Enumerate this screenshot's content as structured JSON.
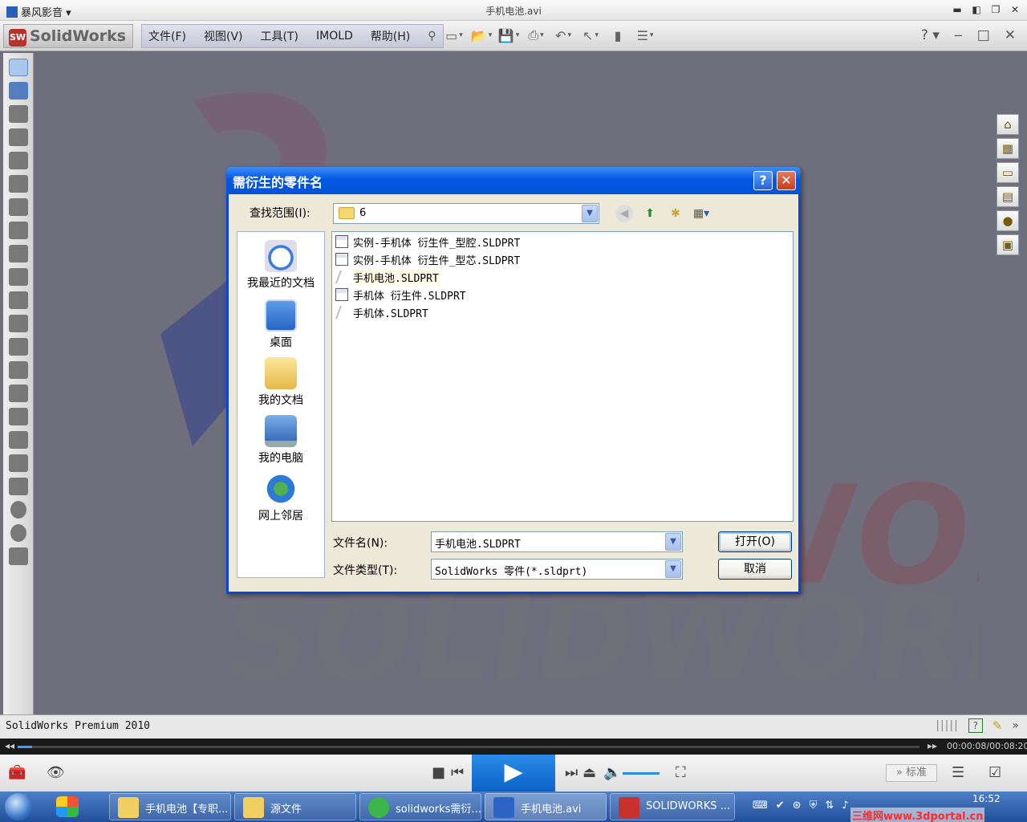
{
  "player": {
    "app_name": "暴风影音",
    "file_title": "手机电池.avi",
    "progress_fraction": 0.016,
    "time_readout": "00:00:08/00:08:20",
    "mode_button": "标准"
  },
  "sw": {
    "logo_text": "SolidWorks",
    "menus": [
      "文件(F)",
      "视图(V)",
      "工具(T)",
      "IMOLD",
      "帮助(H)"
    ],
    "status_text": "SolidWorks Premium 2010"
  },
  "dialog": {
    "title": "需衍生的零件名",
    "help_glyph": "?",
    "close_glyph": "✕",
    "look_in_label": "查找范围(I):",
    "look_in_value": "6",
    "places": [
      "我最近的文档",
      "桌面",
      "我的文档",
      "我的电脑",
      "网上邻居"
    ],
    "files": [
      {
        "name": "实例-手机体 衍生件_型腔.SLDPRT",
        "icon": "derived-part-icon"
      },
      {
        "name": "实例-手机体 衍生件_型芯.SLDPRT",
        "icon": "derived-part-icon"
      },
      {
        "name": "手机电池.SLDPRT",
        "icon": "part-icon"
      },
      {
        "name": "手机体 衍生件.SLDPRT",
        "icon": "derived-part-icon"
      },
      {
        "name": "手机体.SLDPRT",
        "icon": "part-icon"
      }
    ],
    "filename_label": "文件名(N):",
    "filename_value": "手机电池.SLDPRT",
    "filetype_label": "文件类型(T):",
    "filetype_value": "SolidWorks 零件(*.sldprt)",
    "open_button": "打开(O)",
    "cancel_button": "取消"
  },
  "taskbar": {
    "tasks": [
      "手机电池【专职...",
      "源文件",
      "solidworks需衍...",
      "手机电池.avi",
      "SOLIDWORKS ..."
    ],
    "clock": "16:52",
    "watermark": "三维网www.3dportal.cn"
  }
}
